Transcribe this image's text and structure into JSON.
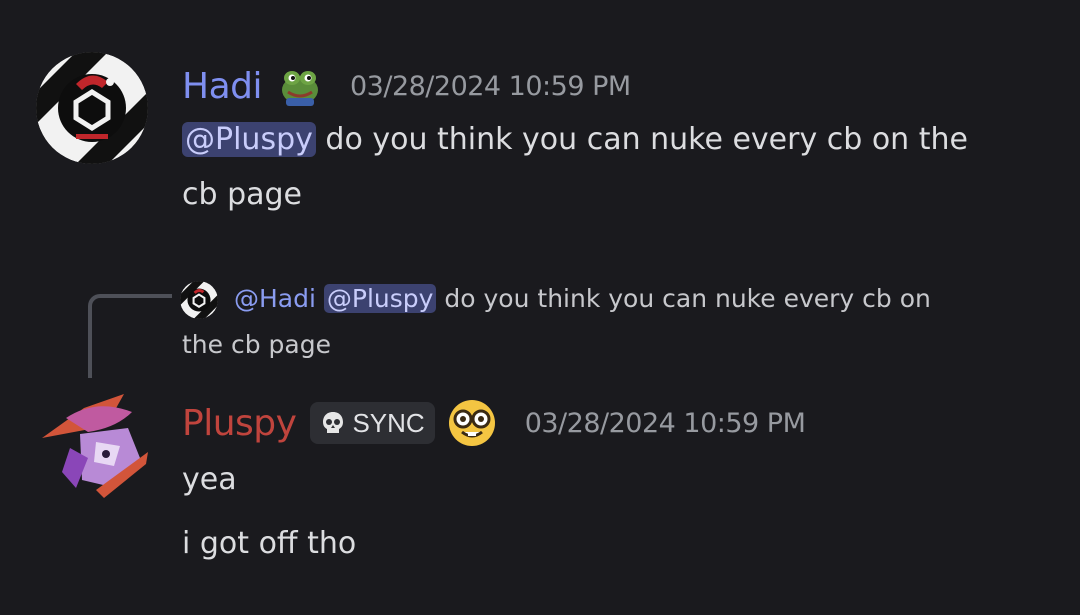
{
  "messages": [
    {
      "author": "Hadi",
      "author_color": "#7f8ff0",
      "timestamp": "03/28/2024 10:59 PM",
      "mention": "@Pluspy",
      "text_line1": " do you think you can nuke every cb on the",
      "text_line2": "cb page"
    },
    {
      "reply": {
        "author": "@Hadi",
        "mention": "@Pluspy",
        "text_line1": " do you think you can nuke every cb on",
        "text_line2": "the cb page"
      },
      "author": "Pluspy",
      "author_color": "#c0443d",
      "tag_icon": "skull-icon",
      "tag": "SYNC",
      "badge_icon": "nerd-face-emoji-icon",
      "timestamp": "03/28/2024 10:59 PM",
      "lines": [
        "yea",
        "i got off tho"
      ]
    }
  ]
}
